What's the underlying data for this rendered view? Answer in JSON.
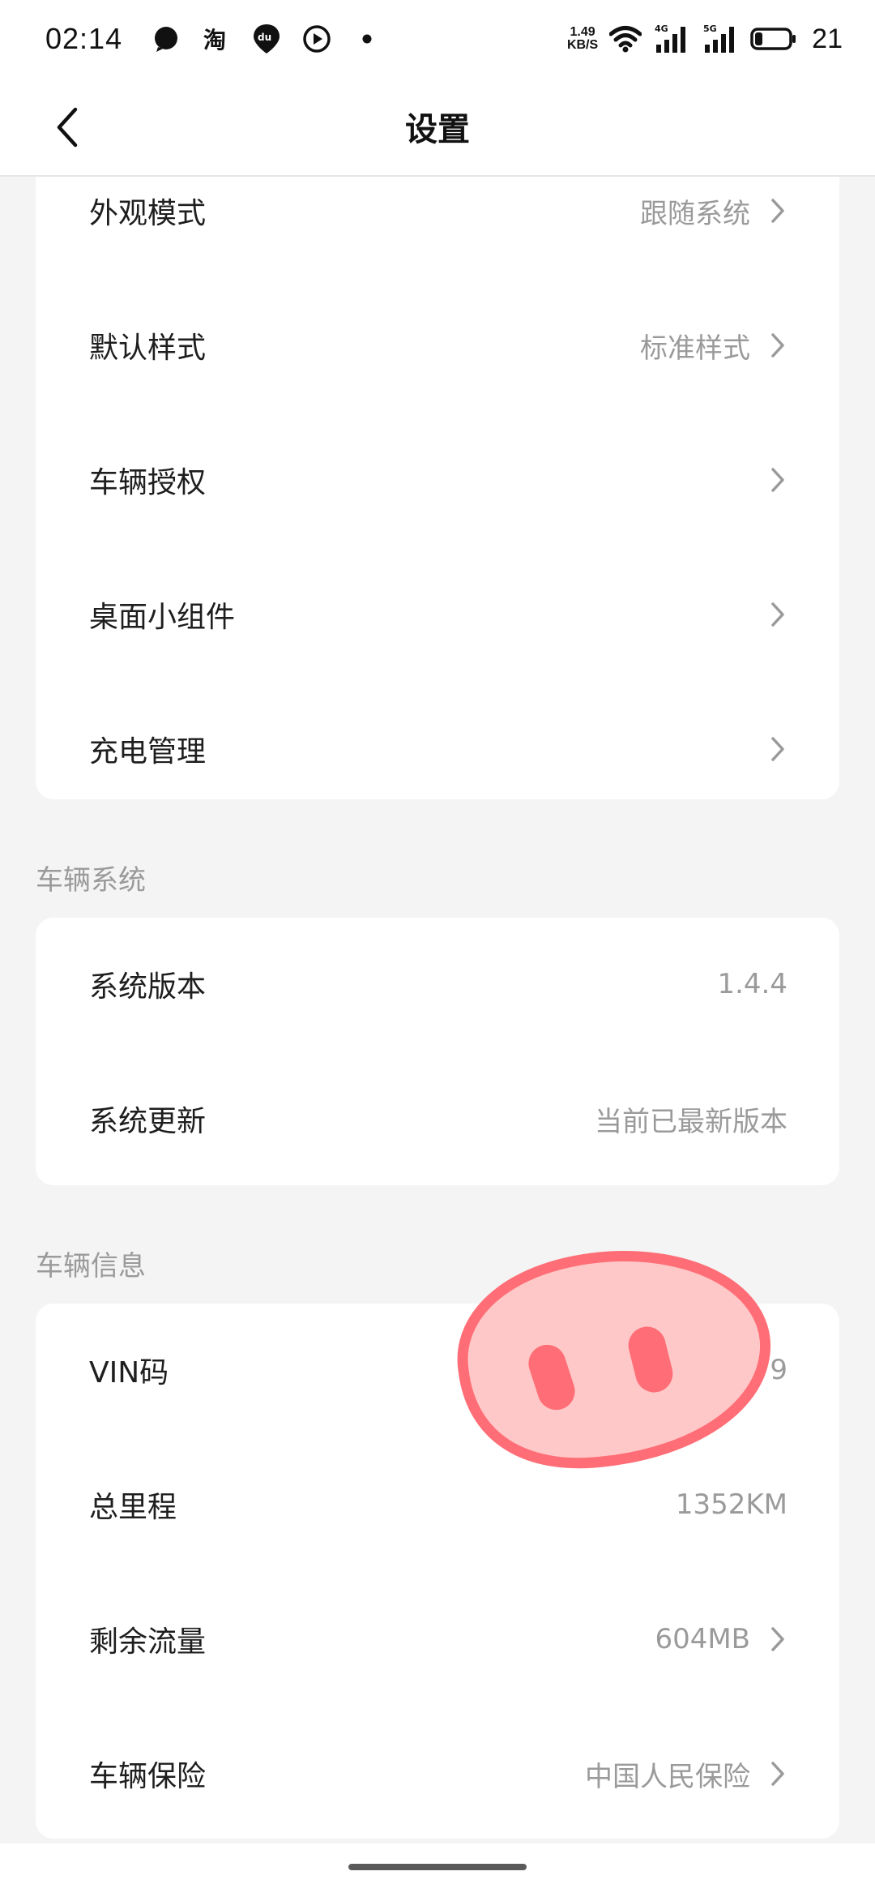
{
  "status_bar": {
    "time": "02:14",
    "left_icons": [
      "message-bubble-icon",
      "taobao-icon",
      "du-map-pin-icon",
      "play-icon",
      "dot-icon"
    ],
    "speed_value": "1.49",
    "speed_unit": "KB/S",
    "net_4g": "4G",
    "net_5g": "5G",
    "battery_level": "21"
  },
  "header": {
    "title": "设置",
    "back_icon": "chevron-left-icon"
  },
  "sections": {
    "display": {
      "items": [
        {
          "label": "外观模式",
          "value": "跟随系统",
          "has_arrow": true
        },
        {
          "label": "默认样式",
          "value": "标准样式",
          "has_arrow": true
        },
        {
          "label": "车辆授权",
          "value": "",
          "has_arrow": true
        },
        {
          "label": "桌面小组件",
          "value": "",
          "has_arrow": true
        },
        {
          "label": "充电管理",
          "value": "",
          "has_arrow": true
        }
      ]
    },
    "vehicle_system": {
      "title": "车辆系统",
      "items": [
        {
          "label": "系统版本",
          "value": "1.4.4",
          "has_arrow": false
        },
        {
          "label": "系统更新",
          "value": "当前已最新版本",
          "has_arrow": false
        }
      ]
    },
    "vehicle_info": {
      "title": "车辆信息",
      "items": [
        {
          "label": "VIN码",
          "value": "9",
          "has_arrow": false
        },
        {
          "label": "总里程",
          "value": "1352KM",
          "has_arrow": false
        },
        {
          "label": "剩余流量",
          "value": "604MB",
          "has_arrow": true
        },
        {
          "label": "车辆保险",
          "value": "中国人民保险",
          "has_arrow": true
        }
      ]
    }
  },
  "colors": {
    "background": "#f4f4f4",
    "card": "#ffffff",
    "label": "#1e1e1e",
    "value": "#9a9a9a",
    "sticker_fill": "#ffc8c8",
    "sticker_stroke": "#ff6e76"
  }
}
